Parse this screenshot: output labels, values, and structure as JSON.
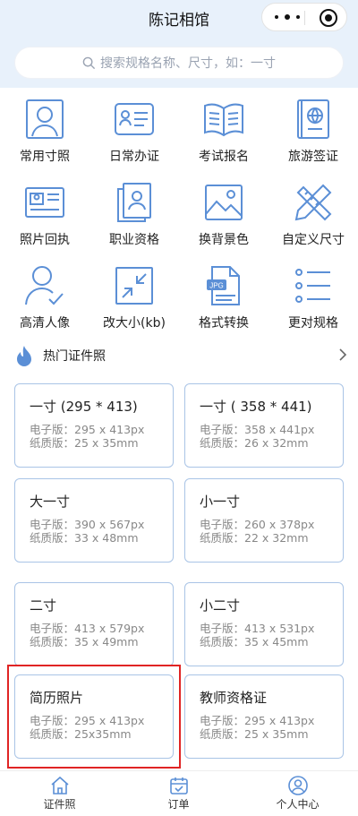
{
  "header": {
    "title": "陈记相馆"
  },
  "search": {
    "placeholder": "搜索规格名称、尺寸，如：一寸"
  },
  "categories": [
    {
      "label": "常用寸照",
      "icon": "person-portrait-icon"
    },
    {
      "label": "日常办证",
      "icon": "id-card-icon"
    },
    {
      "label": "考试报名",
      "icon": "open-book-icon"
    },
    {
      "label": "旅游签证",
      "icon": "passport-icon"
    },
    {
      "label": "照片回执",
      "icon": "receipt-card-icon"
    },
    {
      "label": "职业资格",
      "icon": "certificate-icon"
    },
    {
      "label": "换背景色",
      "icon": "landscape-image-icon"
    },
    {
      "label": "自定义尺寸",
      "icon": "ruler-pencil-icon"
    },
    {
      "label": "高清人像",
      "icon": "person-check-icon"
    },
    {
      "label": "改大小(kb)",
      "icon": "resize-arrows-icon"
    },
    {
      "label": "格式转换",
      "icon": "jpg-file-icon"
    },
    {
      "label": "更对规格",
      "icon": "list-icon"
    }
  ],
  "hot_section": {
    "title": "热门证件照"
  },
  "cards": [
    {
      "name": "一寸 (295 * 413)",
      "electronic": "电子版：295 x 413px",
      "paper": "纸质版：25 x 35mm"
    },
    {
      "name": "一寸 ( 358 * 441)",
      "electronic": "电子版：358 x 441px",
      "paper": "纸质版：26 x 32mm"
    },
    {
      "name": "大一寸",
      "electronic": "电子版：390 x 567px",
      "paper": "纸质版：33 x 48mm"
    },
    {
      "name": "小一寸",
      "electronic": "电子版：260 x 378px",
      "paper": "纸质版：22 x 32mm"
    },
    {
      "name": "二寸",
      "electronic": "电子版：413 x 579px",
      "paper": "纸质版：35 x 49mm"
    },
    {
      "name": "小二寸",
      "electronic": "电子版：413 x 531px",
      "paper": "纸质版：35 x 45mm"
    },
    {
      "name": "简历照片",
      "electronic": "电子版：295 x 413px",
      "paper": "纸质版：25x35mm"
    },
    {
      "name": "教师资格证",
      "electronic": "电子版：295 x 413px",
      "paper": "纸质版：25 x 35mm"
    }
  ],
  "tabbar": [
    {
      "label": "证件照",
      "icon": "home-icon"
    },
    {
      "label": "订单",
      "icon": "calendar-icon"
    },
    {
      "label": "个人中心",
      "icon": "user-icon"
    }
  ],
  "colors": {
    "accent": "#5b8fd6",
    "header_bg": "#e8f1fb",
    "highlight": "#e02424"
  }
}
